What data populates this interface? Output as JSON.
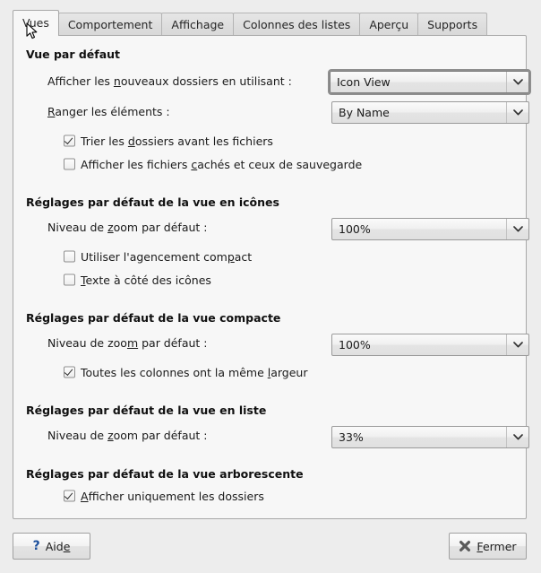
{
  "tabs": [
    {
      "label": "Vues",
      "active": true
    },
    {
      "label": "Comportement",
      "active": false
    },
    {
      "label": "Affichage",
      "active": false
    },
    {
      "label": "Colonnes des listes",
      "active": false
    },
    {
      "label": "Aperçu",
      "active": false
    },
    {
      "label": "Supports",
      "active": false
    }
  ],
  "sections": {
    "default_view": {
      "title": "Vue par défaut",
      "new_folders_label_pre": "Afficher les ",
      "new_folders_label_mn": "n",
      "new_folders_label_post": "ouveaux dossiers en utilisant :",
      "new_folders_value": "Icon View",
      "arrange_label_mn": "R",
      "arrange_label_post": "anger les éléments :",
      "arrange_value": "By Name",
      "sort_folders_pre": "Trier les ",
      "sort_folders_mn": "d",
      "sort_folders_post": "ossiers avant les fichiers",
      "sort_folders_checked": true,
      "show_hidden_pre": "Afficher les fichiers ",
      "show_hidden_mn": "c",
      "show_hidden_post": "achés et ceux de sauvegarde",
      "show_hidden_checked": false
    },
    "icon_view": {
      "title": "Réglages par défaut de la vue en icônes",
      "zoom_label_pre": "Niveau de ",
      "zoom_label_mn": "z",
      "zoom_label_post": "oom par défaut :",
      "zoom_value": "100%",
      "compact_layout_pre": "Utiliser l'agencement com",
      "compact_layout_mn": "p",
      "compact_layout_post": "act",
      "compact_layout_checked": false,
      "text_beside_pre": "",
      "text_beside_mn": "T",
      "text_beside_post": "exte à côté des icônes",
      "text_beside_checked": false
    },
    "compact_view": {
      "title": "Réglages par défaut de la vue compacte",
      "zoom_label_pre": "Niveau de zoo",
      "zoom_label_mn": "m",
      "zoom_label_post": " par défaut :",
      "zoom_value": "100%",
      "same_width_pre": "Toutes les colonnes ont la même ",
      "same_width_mn": "l",
      "same_width_post": "argeur",
      "same_width_checked": true
    },
    "list_view": {
      "title": "Réglages par défaut de la vue en liste",
      "zoom_label_pre": "Niveau de ",
      "zoom_label_mn": "z",
      "zoom_label_post": "oom par défaut :",
      "zoom_value": "33%"
    },
    "tree_view": {
      "title": "Réglages par défaut de la vue arborescente",
      "folders_only_pre": "",
      "folders_only_mn": "A",
      "folders_only_post": "fficher uniquement les dossiers",
      "folders_only_checked": true
    }
  },
  "footer": {
    "help_label_pre": "Aid",
    "help_label_mn": "e",
    "help_icon": "question-mark-icon",
    "close_label_mn": "F",
    "close_label_post": "ermer",
    "close_icon": "close-x-icon"
  },
  "colors": {
    "panel_bg": "#f7f7f7",
    "window_bg": "#ededed",
    "border": "#a8a8a8",
    "help_accent": "#1b4f9c"
  }
}
